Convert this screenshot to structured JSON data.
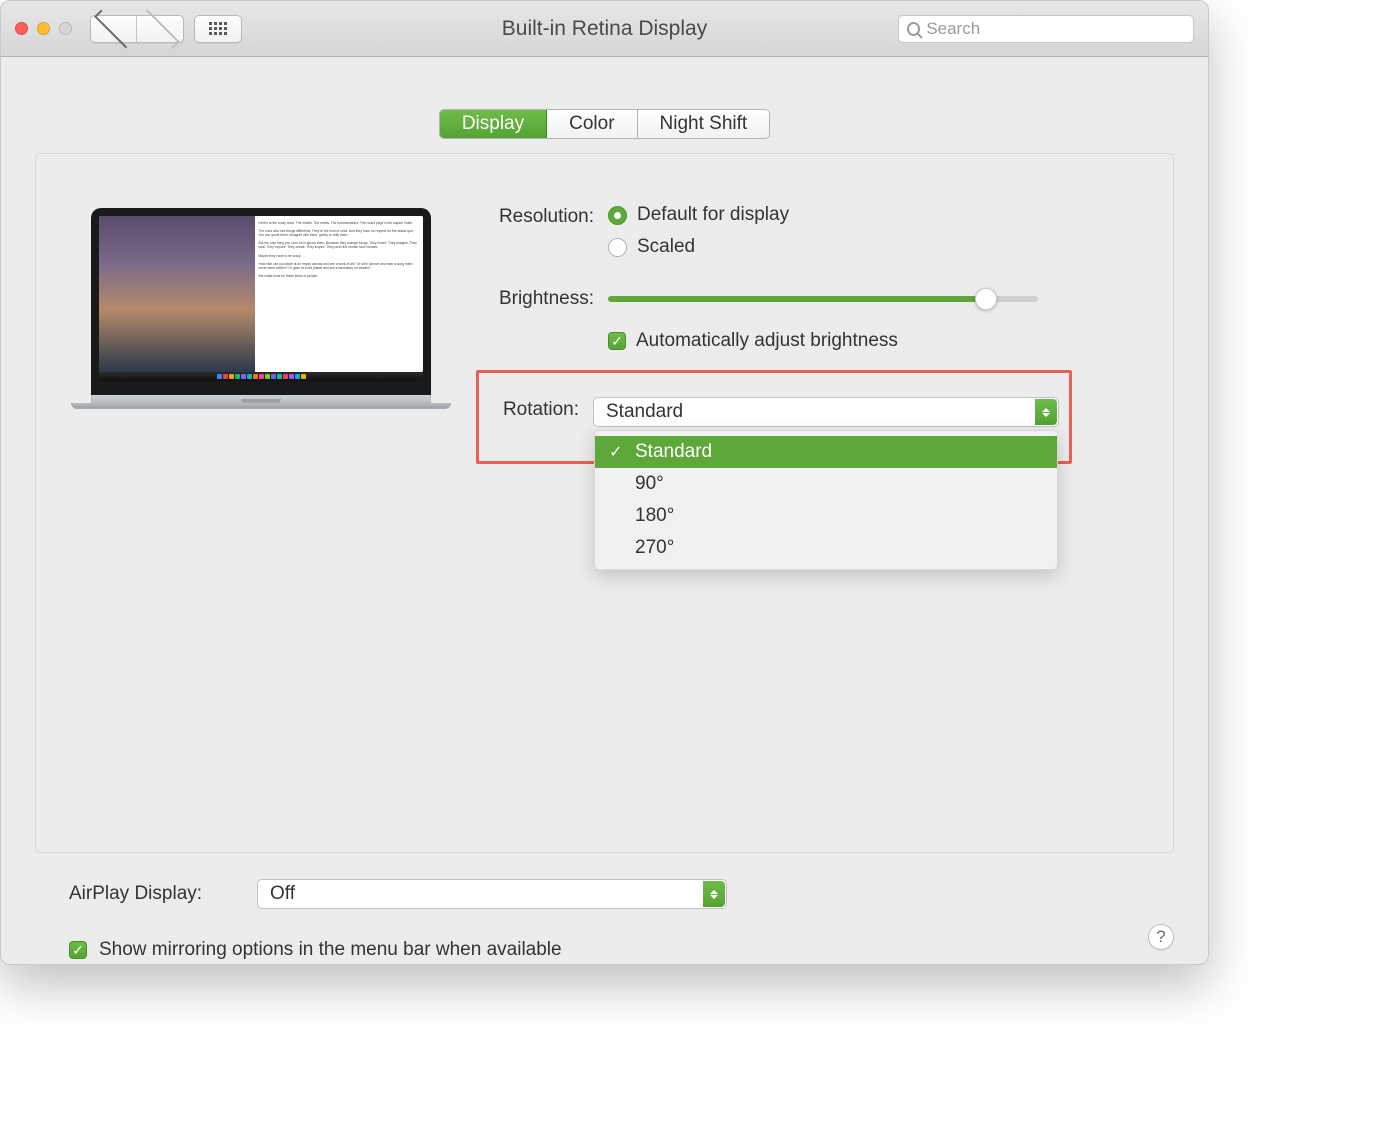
{
  "window_title": "Built-in Retina Display",
  "search_placeholder": "Search",
  "tabs": {
    "display": "Display",
    "color": "Color",
    "night_shift": "Night Shift"
  },
  "resolution": {
    "label": "Resolution:",
    "default": "Default for display",
    "scaled": "Scaled"
  },
  "brightness": {
    "label": "Brightness:",
    "auto": "Automatically adjust brightness"
  },
  "rotation": {
    "label": "Rotation:",
    "selected": "Standard",
    "options": [
      "Standard",
      "90°",
      "180°",
      "270°"
    ]
  },
  "airplay": {
    "label": "AirPlay Display:",
    "value": "Off"
  },
  "mirror": "Show mirroring options in the menu bar when available",
  "help": "?"
}
